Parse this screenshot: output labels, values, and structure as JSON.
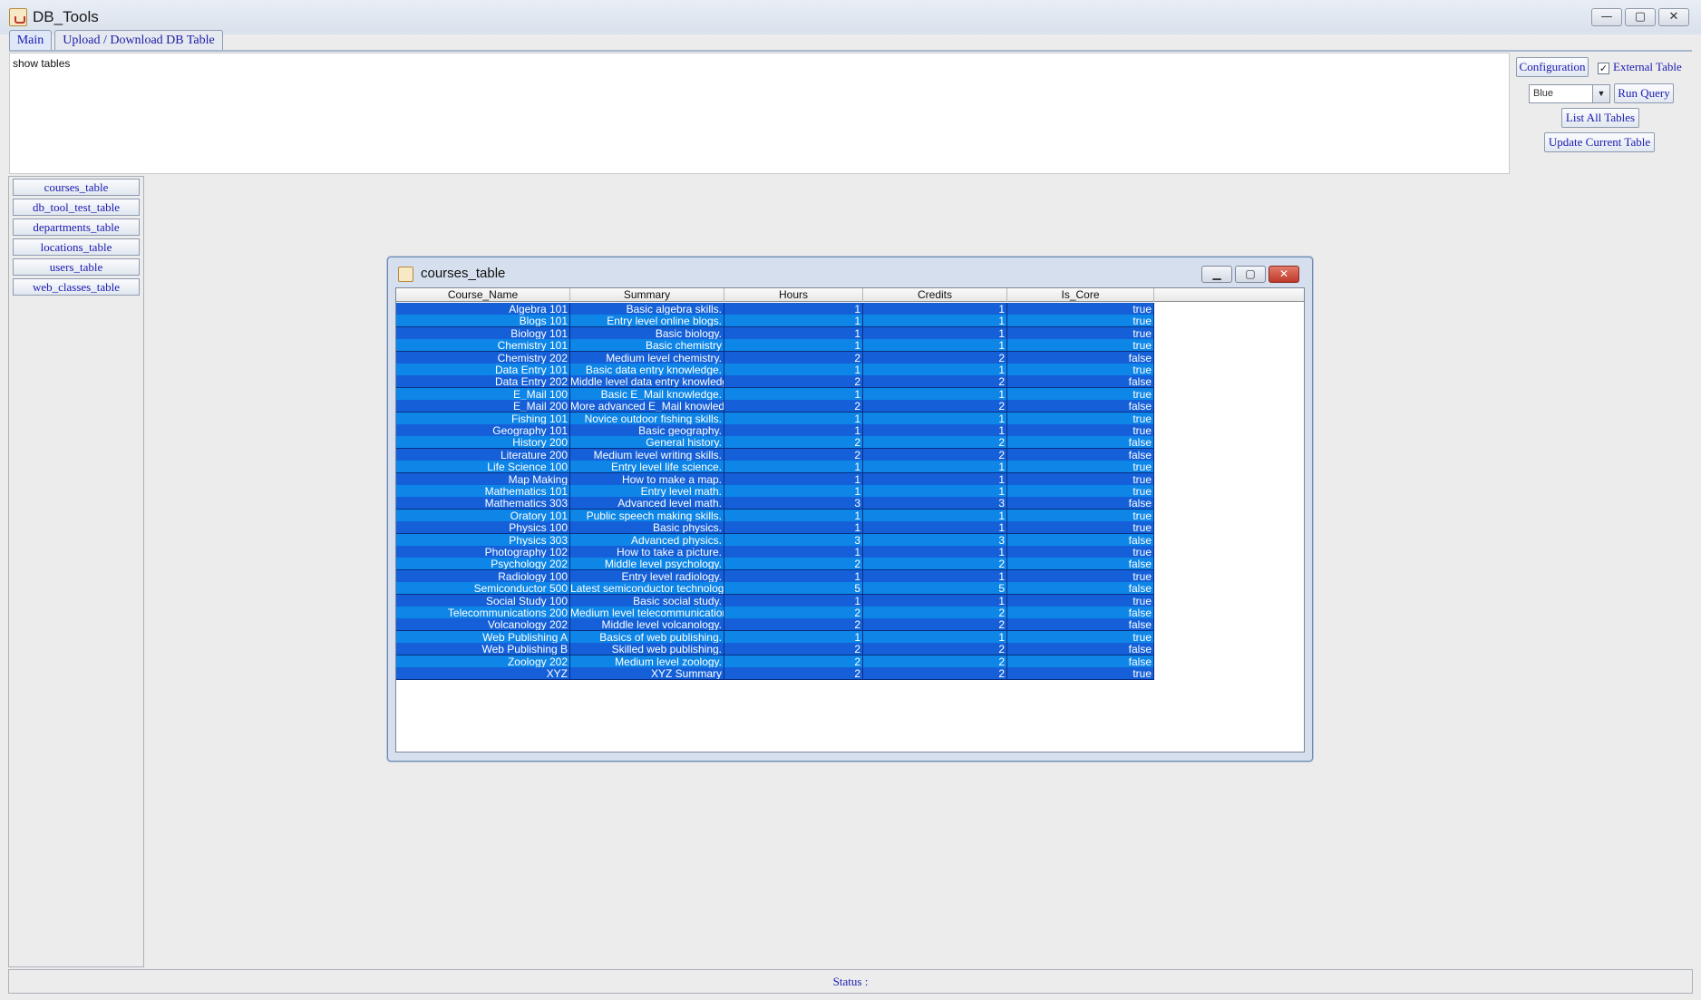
{
  "window": {
    "title": "DB_Tools",
    "controls": [
      "—",
      "▢",
      "✕"
    ]
  },
  "tabs": [
    {
      "label": "Main",
      "active": true
    },
    {
      "label": "Upload / Download DB Table",
      "active": false
    }
  ],
  "query": {
    "text": "show tables"
  },
  "controls": {
    "configuration_label": "Configuration",
    "external_table_label": "External Table",
    "external_table_checked": true,
    "theme_selected": "Blue",
    "run_query_label": "Run Query",
    "list_tables_label": "List All Tables",
    "update_table_label": "Update Current Table"
  },
  "sidebar": {
    "tables": [
      "courses_table",
      "db_tool_test_table",
      "departments_table",
      "locations_table",
      "users_table",
      "web_classes_table"
    ]
  },
  "internal_frame": {
    "title": "courses_table",
    "columns": [
      "Course_Name",
      "Summary",
      "Hours",
      "Credits",
      "Is_Core"
    ],
    "rows": [
      [
        "Algebra 101",
        "Basic algebra skills.",
        "1",
        "1",
        "true"
      ],
      [
        "Blogs 101",
        "Entry level online blogs.",
        "1",
        "1",
        "true"
      ],
      [
        "Biology 101",
        "Basic biology.",
        "1",
        "1",
        "true"
      ],
      [
        "Chemistry 101",
        "Basic chemistry",
        "1",
        "1",
        "true"
      ],
      [
        "Chemistry 202",
        "Medium level  chemistry.",
        "2",
        "2",
        "false"
      ],
      [
        "Data Entry 101",
        "Basic data entry knowledge.",
        "1",
        "1",
        "true"
      ],
      [
        "Data Entry 202",
        "Middle level data entry knowledge.",
        "2",
        "2",
        "false"
      ],
      [
        "E_Mail 100",
        "Basic E_Mail knowledge.",
        "1",
        "1",
        "true"
      ],
      [
        "E_Mail 200",
        "More advanced E_Mail knowledge.",
        "2",
        "2",
        "false"
      ],
      [
        "Fishing 101",
        "Novice outdoor fishing skills.",
        "1",
        "1",
        "true"
      ],
      [
        "Geography 101",
        "Basic geography.",
        "1",
        "1",
        "true"
      ],
      [
        "History 200",
        "General history.",
        "2",
        "2",
        "false"
      ],
      [
        "Literature 200",
        "Medium level writing skills.",
        "2",
        "2",
        "false"
      ],
      [
        "Life Science 100",
        "Entry level life science.",
        "1",
        "1",
        "true"
      ],
      [
        "Map Making",
        "How to make a map.",
        "1",
        "1",
        "true"
      ],
      [
        "Mathematics 101",
        "Entry level math.",
        "1",
        "1",
        "true"
      ],
      [
        "Mathematics 303",
        "Advanced level math.",
        "3",
        "3",
        "false"
      ],
      [
        "Oratory 101",
        "Public speech making skills.",
        "1",
        "1",
        "true"
      ],
      [
        "Physics 100",
        "Basic physics.",
        "1",
        "1",
        "true"
      ],
      [
        "Physics 303",
        "Advanced physics.",
        "3",
        "3",
        "false"
      ],
      [
        "Photography 102",
        "How to take a picture.",
        "1",
        "1",
        "true"
      ],
      [
        "Psychology 202",
        "Middle level psychology.",
        "2",
        "2",
        "false"
      ],
      [
        "Radiology 100",
        "Entry level radiology.",
        "1",
        "1",
        "true"
      ],
      [
        "Semiconductor 500",
        "Latest semiconductor technology.",
        "5",
        "5",
        "false"
      ],
      [
        "Social Study 100",
        "Basic social study.",
        "1",
        "1",
        "true"
      ],
      [
        "Telecommunications 200",
        "Medium level telecommunications.",
        "2",
        "2",
        "false"
      ],
      [
        "Volcanology 202",
        "Middle level volcanology.",
        "2",
        "2",
        "false"
      ],
      [
        "Web Publishing A",
        "Basics of web publishing.",
        "1",
        "1",
        "true"
      ],
      [
        "Web Publishing B",
        "Skilled web publishing.",
        "2",
        "2",
        "false"
      ],
      [
        "Zoology 202",
        "Medium level zoology.",
        "2",
        "2",
        "false"
      ],
      [
        "XYZ",
        "XYZ Summary",
        "2",
        "2",
        "true"
      ]
    ]
  },
  "status": {
    "label": "Status :"
  }
}
